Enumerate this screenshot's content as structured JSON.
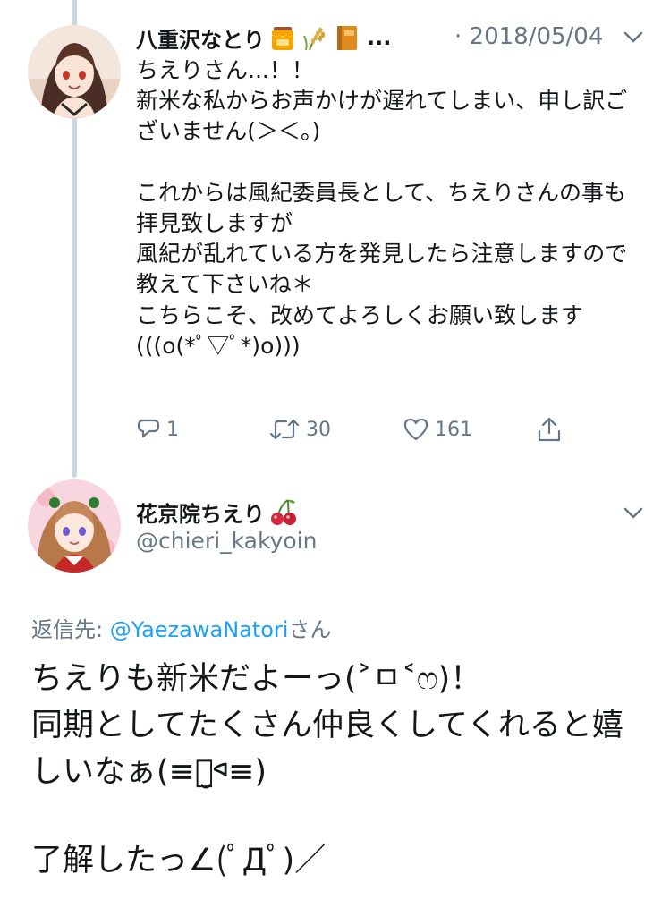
{
  "colors": {
    "text": "#14171a",
    "secondary": "#657786",
    "link": "#1da1f2",
    "thread_line": "#ccd6dd"
  },
  "tweet1": {
    "display_name": "八重沢なとり",
    "name_emojis": [
      "honey-pot-icon",
      "rice-plant-icon",
      "book-icon"
    ],
    "ellipsis": "...",
    "date": "· 2018/05/04",
    "text": "ちえりさん...！！\n新米な私からお声かけが遅れてしまい、申し訳ございません(＞＜。)\n\nこれからは風紀委員長として、ちえりさんの事も拝見致しますが\n風紀が乱れている方を発見したら注意しますので教えて下さいね＊\nこちらこそ、改めてよろしくお願い致します(((o(*ﾟ▽ﾟ*)o)))",
    "actions": {
      "reply_count": "1",
      "retweet_count": "30",
      "like_count": "161"
    }
  },
  "tweet2": {
    "display_name": "花京院ちえり",
    "name_emojis": [
      "cherries-icon"
    ],
    "handle": "@chieri_kakyoin",
    "reply_label": "返信先: ",
    "reply_mention": "@YaezawaNatori",
    "reply_suffix": "さん",
    "text": "ちえりも新米だよーっ(˃ㅁ˂ෆ)！\n同期としてたくさん仲良くしてくれると嬉しいなぁ(≡ᢦ̮ᢦ≡)",
    "text2": "了解したっ∠(ﾟДﾟ)／"
  }
}
